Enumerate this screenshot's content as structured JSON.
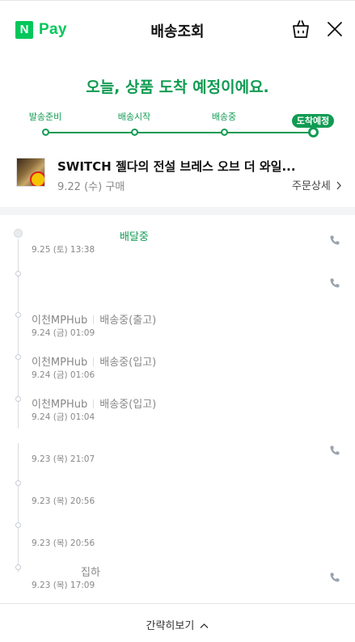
{
  "header": {
    "logo_badge": "N",
    "logo_text": "Pay",
    "title": "배송조회",
    "cart_icon": "shopping-bag-icon",
    "close_icon": "close-icon"
  },
  "headline": "오늘, 상품 도착 예정이에요.",
  "progress": {
    "steps": [
      {
        "label": "발송준비",
        "active": false
      },
      {
        "label": "배송시작",
        "active": false
      },
      {
        "label": "배송중",
        "active": false
      },
      {
        "label": "도착예정",
        "active": true
      }
    ],
    "accent_color": "#109b52"
  },
  "product": {
    "name": "SWITCH 젤다의 전설 브레스 오브 더 와일...",
    "date": "9.22 (수) 구매",
    "detail_link": "주문상세",
    "detail_icon": "chevron-right-icon"
  },
  "timeline": {
    "events": [
      {
        "location": "",
        "status": "배달중",
        "time": "9.25 (토) 13:38",
        "phone": true
      },
      {
        "location": "",
        "status": "",
        "time": "",
        "phone": true
      },
      {
        "location": "이천MPHub",
        "status": "배송중(출고)",
        "time": "9.24 (금) 01:09",
        "phone": false
      },
      {
        "location": "이천MPHub",
        "status": "배송중(입고)",
        "time": "9.24 (금) 01:06",
        "phone": false
      },
      {
        "location": "이천MPHub",
        "status": "배송중(입고)",
        "time": "9.24 (금) 01:04",
        "phone": false
      },
      {
        "location": "",
        "status": "",
        "time": "9.23 (목) 21:07",
        "phone": true
      },
      {
        "location": "",
        "status": "",
        "time": "9.23 (목) 20:56",
        "phone": false
      },
      {
        "location": "",
        "status": "",
        "time": "9.23 (목) 20:56",
        "phone": false
      },
      {
        "location": "",
        "status": "집하",
        "time": "9.23 (목) 17:09",
        "phone": true
      }
    ]
  },
  "footer": {
    "label": "간략히보기",
    "icon": "chevron-up-icon"
  }
}
